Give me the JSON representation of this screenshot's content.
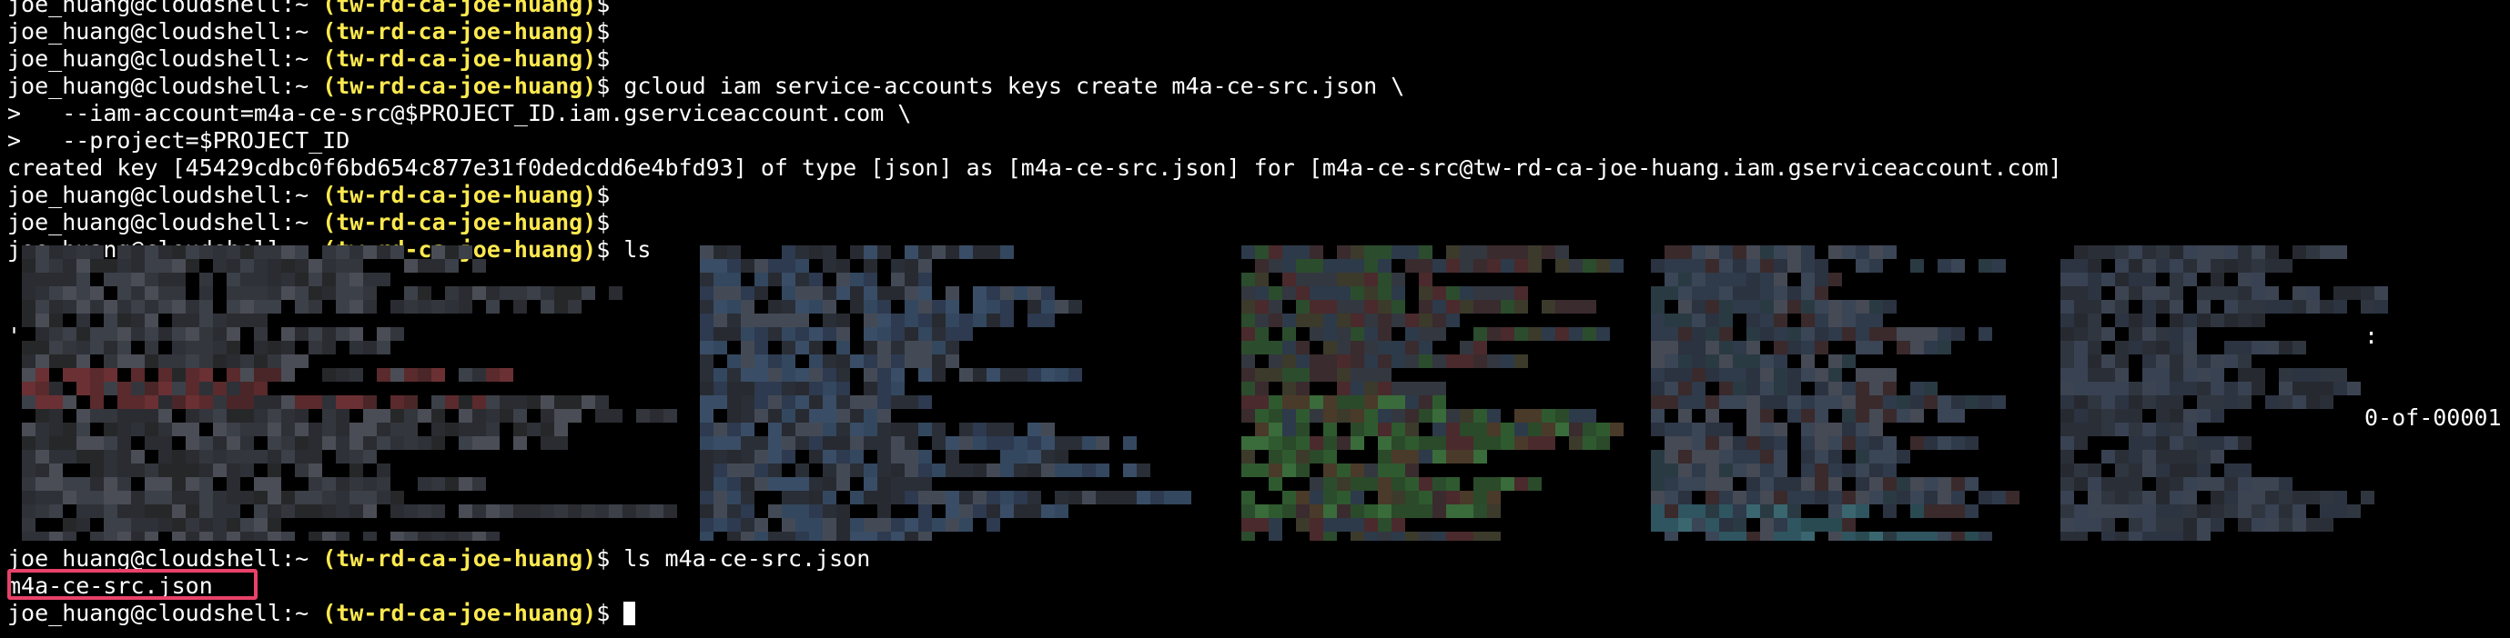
{
  "terminal": {
    "prompt": {
      "user_host": "joe_huang@cloudshell:~",
      "project": "(tw-rd-ca-joe-huang)",
      "symbol": "$"
    },
    "lines_top": [
      {
        "type": "prompt",
        "cmd": ""
      },
      {
        "type": "prompt",
        "cmd": ""
      },
      {
        "type": "prompt",
        "cmd": ""
      },
      {
        "type": "prompt",
        "cmd": "gcloud iam service-accounts keys create m4a-ce-src.json \\"
      },
      {
        "type": "output",
        "text": ">   --iam-account=m4a-ce-src@$PROJECT_ID.iam.gserviceaccount.com \\"
      },
      {
        "type": "output",
        "text": ">   --project=$PROJECT_ID"
      },
      {
        "type": "output",
        "text": "created key [45429cdbc0f6bd654c877e31f0dedcdd6e4bfd93] of type [json] as [m4a-ce-src.json] for [m4a-ce-src@tw-rd-ca-joe-huang.iam.gserviceaccount.com]"
      },
      {
        "type": "prompt",
        "cmd": ""
      },
      {
        "type": "prompt",
        "cmd": ""
      },
      {
        "type": "prompt",
        "cmd": "ls"
      }
    ],
    "redacted_fragments": {
      "right_suffix": "0-of-00001",
      "colon": ":",
      "left_quote": "'"
    },
    "lines_bottom": [
      {
        "type": "prompt",
        "cmd": "ls m4a-ce-src.json"
      },
      {
        "type": "output",
        "text": "m4a-ce-src.json"
      },
      {
        "type": "prompt-cursor",
        "cmd": ""
      }
    ]
  },
  "colors": {
    "background": "#000000",
    "text": "#ffffff",
    "project": "#fce94f",
    "highlight_box": "#e8416a"
  }
}
